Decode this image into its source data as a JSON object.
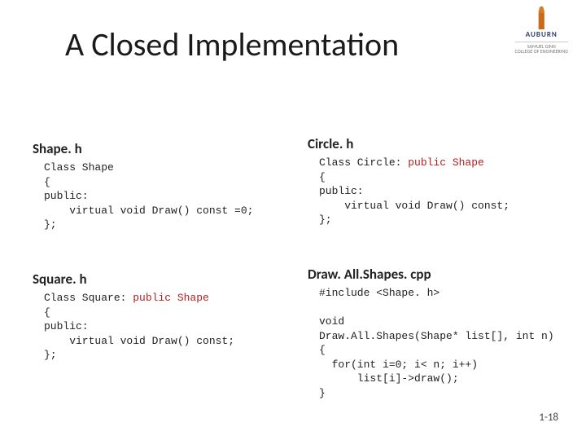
{
  "title": "A Closed Implementation",
  "logo": {
    "name": "AUBURN",
    "unit": "COLLEGE OF ENGINEERING",
    "sub": "SAMUEL GINN"
  },
  "blocks": {
    "shape": {
      "title": "Shape. h",
      "lines": [
        "Class Shape",
        "{",
        "public:",
        "    virtual void Draw() const =0;",
        "};"
      ]
    },
    "square": {
      "title": "Square. h",
      "pre": "Class Square: ",
      "kw": "public Shape",
      "lines": [
        "{",
        "public:",
        "    virtual void Draw() const;",
        "};"
      ]
    },
    "circle": {
      "title": "Circle. h",
      "pre": "Class Circle: ",
      "kw": "public Shape",
      "lines": [
        "{",
        "public:",
        "    virtual void Draw() const;",
        "};"
      ]
    },
    "draw": {
      "title": "Draw. All.Shapes. cpp",
      "lines": [
        "#include <Shape. h>",
        "",
        "void",
        "Draw.All.Shapes(Shape* list[], int n)",
        "{",
        "  for(int i=0; i< n; i++)",
        "      list[i]->draw();",
        "}"
      ]
    }
  },
  "page": "1-18"
}
